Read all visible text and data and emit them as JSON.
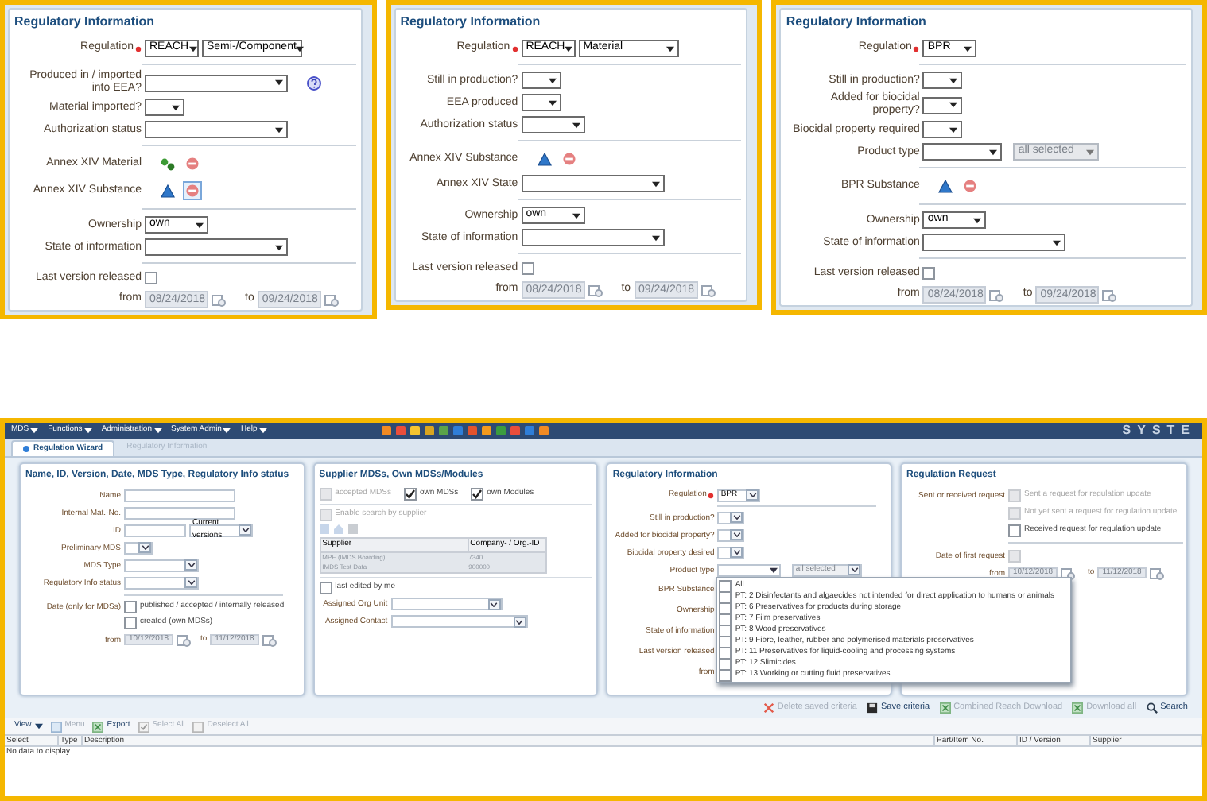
{
  "top_panels": [
    {
      "title": "Regulatory Information",
      "regulation": {
        "label": "Regulation",
        "required": true,
        "value": "REACH",
        "type": "Semi-/Component"
      },
      "sections": [
        [
          {
            "kind": "select",
            "label": "Produced in / imported into EEA?",
            "help": true
          },
          {
            "kind": "yesno",
            "label": "Material imported?"
          },
          {
            "kind": "select",
            "label": "Authorization status"
          }
        ],
        [
          {
            "kind": "annex_material",
            "label": "Annex XIV Material",
            "focused": false
          },
          {
            "kind": "annex_substance",
            "label": "Annex XIV Substance",
            "focused": true
          }
        ],
        [
          {
            "kind": "choice",
            "label": "Ownership",
            "value": "own"
          },
          {
            "kind": "select",
            "label": "State of information"
          }
        ]
      ],
      "last_version": {
        "label": "Last version released",
        "checked": false
      },
      "dates": {
        "from_label": "from",
        "from": "08/24/2018",
        "to_label": "to",
        "to": "09/24/2018"
      }
    },
    {
      "title": "Regulatory Information",
      "regulation": {
        "label": "Regulation",
        "required": true,
        "value": "REACH",
        "type": "Material"
      },
      "sections": [
        [
          {
            "kind": "yesno",
            "label": "Still in production?"
          },
          {
            "kind": "yesno",
            "label": "EEA produced"
          },
          {
            "kind": "choice",
            "label": "Authorization status"
          }
        ],
        [
          {
            "kind": "annex_substance",
            "label": "Annex XIV Substance",
            "focused": false
          },
          {
            "kind": "select",
            "label": "Annex XIV State"
          }
        ],
        [
          {
            "kind": "choice",
            "label": "Ownership",
            "value": "own"
          },
          {
            "kind": "select",
            "label": "State of information"
          }
        ]
      ],
      "last_version": {
        "label": "Last version released",
        "checked": false
      },
      "dates": {
        "from_label": "from",
        "from": "08/24/2018",
        "to_label": "to",
        "to": "09/24/2018"
      }
    },
    {
      "title": "Regulatory Information",
      "regulation": {
        "label": "Regulation",
        "required": true,
        "value": "BPR"
      },
      "sections": [
        [
          {
            "kind": "yesno",
            "label": "Still in production?"
          },
          {
            "kind": "yesno",
            "label": "Added for biocidal property?"
          },
          {
            "kind": "yesno",
            "label": "Biocidal property required"
          },
          {
            "kind": "multi",
            "label": "Product type",
            "summary": "all selected"
          }
        ],
        [
          {
            "kind": "annex_substance",
            "label": "BPR Substance",
            "focused": false
          }
        ],
        [
          {
            "kind": "choice",
            "label": "Ownership",
            "value": "own"
          },
          {
            "kind": "select",
            "label": "State of information"
          }
        ]
      ],
      "last_version": {
        "label": "Last version released",
        "checked": false
      },
      "dates": {
        "from_label": "from",
        "from": "08/24/2018",
        "to_label": "to",
        "to": "09/24/2018"
      }
    }
  ],
  "app": {
    "menu": [
      "MDS",
      "Functions",
      "Administration",
      "System Admin",
      "Help"
    ],
    "brand": "SYSTE",
    "tabs": [
      {
        "label": "Regulation Wizard",
        "selected": true
      },
      {
        "label": "Regulatory Information",
        "selected": false
      }
    ],
    "search_panel": {
      "title": "Name, ID, Version, Date, MDS Type, Regulatory Info status",
      "fields": [
        {
          "kind": "text",
          "label": "Name"
        },
        {
          "kind": "text",
          "label": "Internal Mat.-No."
        },
        {
          "kind": "text_select",
          "label": "ID",
          "value": "Current versions"
        },
        {
          "kind": "select_xs",
          "label": "Preliminary MDS"
        },
        {
          "kind": "select_m",
          "label": "MDS Type"
        },
        {
          "kind": "select_m",
          "label": "Regulatory Info status"
        }
      ],
      "date_label": "Date (only for MDSs)",
      "date_options": [
        {
          "label": "published / accepted / internally released",
          "checked": false
        },
        {
          "label": "created (own MDSs)",
          "checked": false
        }
      ],
      "dates": {
        "from_label": "from",
        "from": "10/12/2018",
        "to_label": "to",
        "to": "11/12/2018"
      }
    },
    "supplier_panel": {
      "title": "Supplier MDSs, Own MDSs/Modules",
      "options": [
        {
          "label": "accepted MDSs",
          "checked": false,
          "disabled": true
        },
        {
          "label": "own MDSs",
          "checked": true,
          "disabled": false
        },
        {
          "label": "own Modules",
          "checked": true,
          "disabled": false
        }
      ],
      "enable_search": {
        "label": "Enable search by supplier",
        "checked": false,
        "disabled": true
      },
      "columns": [
        "Supplier",
        "Company- / Org.-ID"
      ],
      "rows": [
        [
          "MPE (IMDS Boarding)",
          "7340"
        ],
        [
          "IMDS Test Data",
          "900000"
        ]
      ],
      "last_edited": {
        "label": "last edited by me",
        "checked": false
      },
      "fields": [
        {
          "label": "Assigned Org Unit"
        },
        {
          "label": "Assigned Contact"
        }
      ]
    },
    "regulatory_panel": {
      "title": "Regulatory Information",
      "regulation": {
        "label": "Regulation",
        "required": true,
        "value": "BPR"
      },
      "fields": [
        {
          "kind": "yesno",
          "label": "Still in production?"
        },
        {
          "kind": "yesno",
          "label": "Added for biocidal property?"
        },
        {
          "kind": "yesno",
          "label": "Biocidal property desired"
        },
        {
          "kind": "multi",
          "label": "Product type",
          "summary": "all selected"
        },
        {
          "kind": "covered",
          "label": "BPR Substance"
        },
        {
          "kind": "covered",
          "label": "Ownership"
        },
        {
          "kind": "covered",
          "label": "State of information"
        },
        {
          "kind": "covered",
          "label": "Last version released"
        },
        {
          "kind": "covered",
          "label": "from"
        }
      ],
      "product_types": [
        {
          "label": "All",
          "checked": false
        },
        {
          "label": "PT: 2 Disinfectants and algaecides not intended for direct application to humans or animals",
          "checked": false
        },
        {
          "label": "PT: 6 Preservatives for products during storage",
          "checked": false
        },
        {
          "label": "PT: 7 Film preservatives",
          "checked": false
        },
        {
          "label": "PT: 8 Wood preservatives",
          "checked": false
        },
        {
          "label": "PT: 9 Fibre, leather, rubber and polymerised materials preservatives",
          "checked": false
        },
        {
          "label": "PT: 11 Preservatives for liquid-cooling and processing systems",
          "checked": false
        },
        {
          "label": "PT: 12 Slimicides",
          "checked": false
        },
        {
          "label": "PT: 13 Working or cutting fluid preservatives",
          "checked": false
        }
      ]
    },
    "request_panel": {
      "title": "Regulation Request",
      "request_label": "Sent or received request",
      "requests": [
        {
          "label": "Sent a request for regulation update",
          "checked": false,
          "disabled": true
        },
        {
          "label": "Not yet sent a request for regulation update",
          "checked": false,
          "disabled": true
        },
        {
          "label": "Received request for regulation update",
          "checked": false,
          "disabled": false
        }
      ],
      "first_request": {
        "label": "Date of first request",
        "checked": false,
        "disabled": true
      },
      "dates": {
        "from_label": "from",
        "from": "10/12/2018",
        "to_label": "to",
        "to": "11/12/2018"
      }
    },
    "actions": [
      {
        "label": "Delete saved criteria",
        "disabled": true
      },
      {
        "label": "Save criteria",
        "disabled": false
      },
      {
        "label": "Combined Reach Download",
        "disabled": true
      },
      {
        "label": "Download all",
        "disabled": true
      },
      {
        "label": "Search",
        "disabled": false
      }
    ],
    "grid_toolbar": [
      {
        "label": "View",
        "disabled": false
      },
      {
        "label": "Menu",
        "disabled": true
      },
      {
        "label": "Export",
        "disabled": false
      },
      {
        "label": "Select All",
        "disabled": true
      },
      {
        "label": "Deselect All",
        "disabled": true
      }
    ],
    "table": {
      "columns": [
        "Select",
        "Type",
        "Description",
        "Part/Item No.",
        "ID / Version",
        "Supplier"
      ],
      "empty": "No data to display"
    }
  }
}
